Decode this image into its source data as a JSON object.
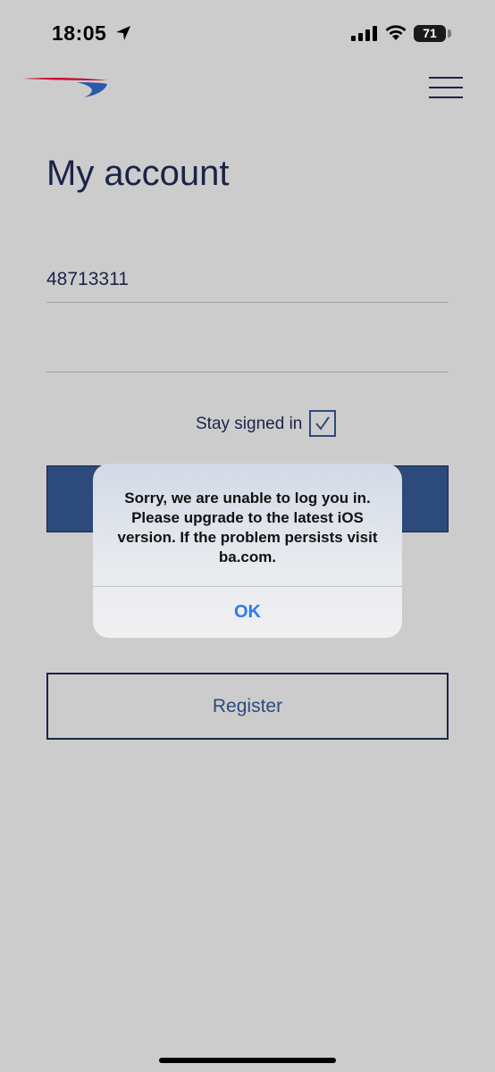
{
  "status_bar": {
    "time": "18:05",
    "battery": "71",
    "icons": [
      "location-arrow-icon",
      "signal-icon",
      "wifi-icon",
      "battery-icon"
    ]
  },
  "header": {
    "logo_icon": "british-airways-speedmarque",
    "menu_icon": "hamburger-menu-icon"
  },
  "page": {
    "title": "My account"
  },
  "form": {
    "username_value": "48713311",
    "password_value": "",
    "stay_signed_in_label": "Stay signed in",
    "stay_signed_in_checked": true,
    "register_label": "Register"
  },
  "alert": {
    "message": "Sorry, we are unable to log you in. Please upgrade to the latest iOS version. If the problem persists visit ba.com.",
    "ok_label": "OK"
  },
  "colors": {
    "background": "#cccccc",
    "navy": "#1b2348",
    "primary_button": "#2c4a7c",
    "alert_action": "#2f7bea",
    "logo_red": "#c8102e",
    "logo_blue": "#2b5aa8"
  }
}
